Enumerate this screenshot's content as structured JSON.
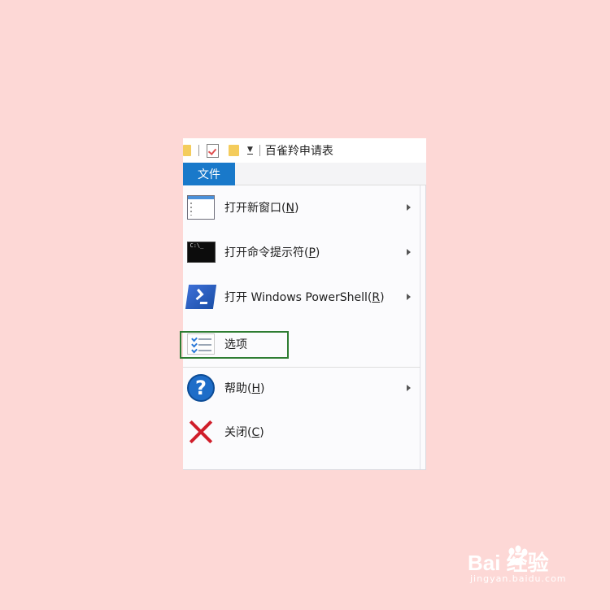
{
  "title_bar": {
    "title": "百雀羚申请表"
  },
  "ribbon": {
    "file_tab_label": "文件"
  },
  "menu": {
    "items": [
      {
        "label": "打开新窗口",
        "key": "N",
        "icon": "new-window-icon",
        "has_submenu": true
      },
      {
        "label": "打开命令提示符",
        "key": "P",
        "icon": "command-prompt-icon",
        "has_submenu": true
      },
      {
        "label": "打开 Windows PowerShell",
        "key": "R",
        "icon": "powershell-icon",
        "has_submenu": true
      },
      {
        "label": "选项",
        "key": "",
        "icon": "options-icon",
        "has_submenu": false
      },
      {
        "label": "帮助",
        "key": "H",
        "icon": "help-icon",
        "has_submenu": true
      },
      {
        "label": "关闭",
        "key": "C",
        "icon": "close-icon",
        "has_submenu": false
      }
    ],
    "cmd_icon_text": "C:\\_"
  },
  "colors": {
    "background": "#fdd8d6",
    "file_tab": "#1979ca",
    "highlight_box": "#2e7d32",
    "close_red": "#d01e2a"
  },
  "watermark": {
    "logo": "Bai  经验",
    "sub": "jingyan.baidu.com"
  }
}
